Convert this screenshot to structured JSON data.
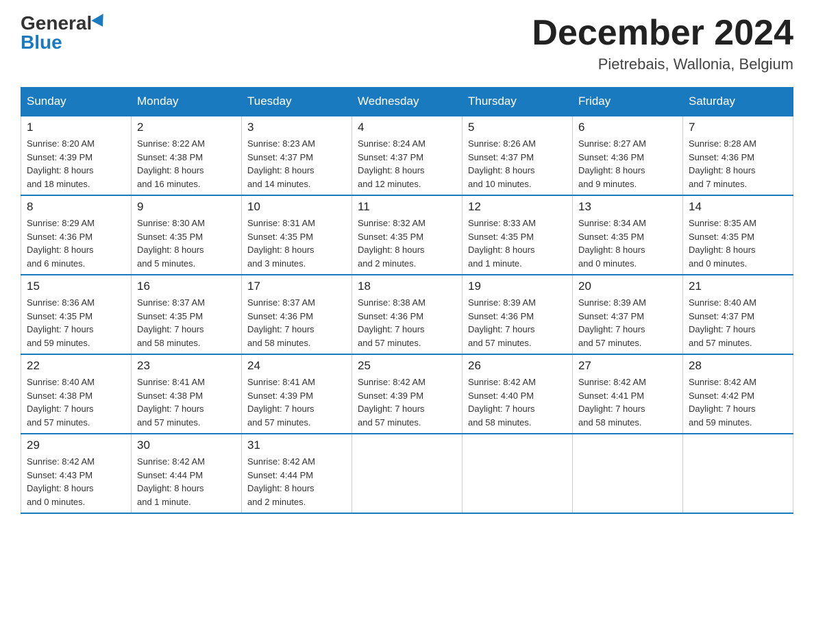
{
  "header": {
    "logo_general": "General",
    "logo_blue": "Blue",
    "month_title": "December 2024",
    "location": "Pietrebais, Wallonia, Belgium"
  },
  "days_of_week": [
    "Sunday",
    "Monday",
    "Tuesday",
    "Wednesday",
    "Thursday",
    "Friday",
    "Saturday"
  ],
  "weeks": [
    [
      {
        "day": "1",
        "info": "Sunrise: 8:20 AM\nSunset: 4:39 PM\nDaylight: 8 hours\nand 18 minutes."
      },
      {
        "day": "2",
        "info": "Sunrise: 8:22 AM\nSunset: 4:38 PM\nDaylight: 8 hours\nand 16 minutes."
      },
      {
        "day": "3",
        "info": "Sunrise: 8:23 AM\nSunset: 4:37 PM\nDaylight: 8 hours\nand 14 minutes."
      },
      {
        "day": "4",
        "info": "Sunrise: 8:24 AM\nSunset: 4:37 PM\nDaylight: 8 hours\nand 12 minutes."
      },
      {
        "day": "5",
        "info": "Sunrise: 8:26 AM\nSunset: 4:37 PM\nDaylight: 8 hours\nand 10 minutes."
      },
      {
        "day": "6",
        "info": "Sunrise: 8:27 AM\nSunset: 4:36 PM\nDaylight: 8 hours\nand 9 minutes."
      },
      {
        "day": "7",
        "info": "Sunrise: 8:28 AM\nSunset: 4:36 PM\nDaylight: 8 hours\nand 7 minutes."
      }
    ],
    [
      {
        "day": "8",
        "info": "Sunrise: 8:29 AM\nSunset: 4:36 PM\nDaylight: 8 hours\nand 6 minutes."
      },
      {
        "day": "9",
        "info": "Sunrise: 8:30 AM\nSunset: 4:35 PM\nDaylight: 8 hours\nand 5 minutes."
      },
      {
        "day": "10",
        "info": "Sunrise: 8:31 AM\nSunset: 4:35 PM\nDaylight: 8 hours\nand 3 minutes."
      },
      {
        "day": "11",
        "info": "Sunrise: 8:32 AM\nSunset: 4:35 PM\nDaylight: 8 hours\nand 2 minutes."
      },
      {
        "day": "12",
        "info": "Sunrise: 8:33 AM\nSunset: 4:35 PM\nDaylight: 8 hours\nand 1 minute."
      },
      {
        "day": "13",
        "info": "Sunrise: 8:34 AM\nSunset: 4:35 PM\nDaylight: 8 hours\nand 0 minutes."
      },
      {
        "day": "14",
        "info": "Sunrise: 8:35 AM\nSunset: 4:35 PM\nDaylight: 8 hours\nand 0 minutes."
      }
    ],
    [
      {
        "day": "15",
        "info": "Sunrise: 8:36 AM\nSunset: 4:35 PM\nDaylight: 7 hours\nand 59 minutes."
      },
      {
        "day": "16",
        "info": "Sunrise: 8:37 AM\nSunset: 4:35 PM\nDaylight: 7 hours\nand 58 minutes."
      },
      {
        "day": "17",
        "info": "Sunrise: 8:37 AM\nSunset: 4:36 PM\nDaylight: 7 hours\nand 58 minutes."
      },
      {
        "day": "18",
        "info": "Sunrise: 8:38 AM\nSunset: 4:36 PM\nDaylight: 7 hours\nand 57 minutes."
      },
      {
        "day": "19",
        "info": "Sunrise: 8:39 AM\nSunset: 4:36 PM\nDaylight: 7 hours\nand 57 minutes."
      },
      {
        "day": "20",
        "info": "Sunrise: 8:39 AM\nSunset: 4:37 PM\nDaylight: 7 hours\nand 57 minutes."
      },
      {
        "day": "21",
        "info": "Sunrise: 8:40 AM\nSunset: 4:37 PM\nDaylight: 7 hours\nand 57 minutes."
      }
    ],
    [
      {
        "day": "22",
        "info": "Sunrise: 8:40 AM\nSunset: 4:38 PM\nDaylight: 7 hours\nand 57 minutes."
      },
      {
        "day": "23",
        "info": "Sunrise: 8:41 AM\nSunset: 4:38 PM\nDaylight: 7 hours\nand 57 minutes."
      },
      {
        "day": "24",
        "info": "Sunrise: 8:41 AM\nSunset: 4:39 PM\nDaylight: 7 hours\nand 57 minutes."
      },
      {
        "day": "25",
        "info": "Sunrise: 8:42 AM\nSunset: 4:39 PM\nDaylight: 7 hours\nand 57 minutes."
      },
      {
        "day": "26",
        "info": "Sunrise: 8:42 AM\nSunset: 4:40 PM\nDaylight: 7 hours\nand 58 minutes."
      },
      {
        "day": "27",
        "info": "Sunrise: 8:42 AM\nSunset: 4:41 PM\nDaylight: 7 hours\nand 58 minutes."
      },
      {
        "day": "28",
        "info": "Sunrise: 8:42 AM\nSunset: 4:42 PM\nDaylight: 7 hours\nand 59 minutes."
      }
    ],
    [
      {
        "day": "29",
        "info": "Sunrise: 8:42 AM\nSunset: 4:43 PM\nDaylight: 8 hours\nand 0 minutes."
      },
      {
        "day": "30",
        "info": "Sunrise: 8:42 AM\nSunset: 4:44 PM\nDaylight: 8 hours\nand 1 minute."
      },
      {
        "day": "31",
        "info": "Sunrise: 8:42 AM\nSunset: 4:44 PM\nDaylight: 8 hours\nand 2 minutes."
      },
      null,
      null,
      null,
      null
    ]
  ]
}
